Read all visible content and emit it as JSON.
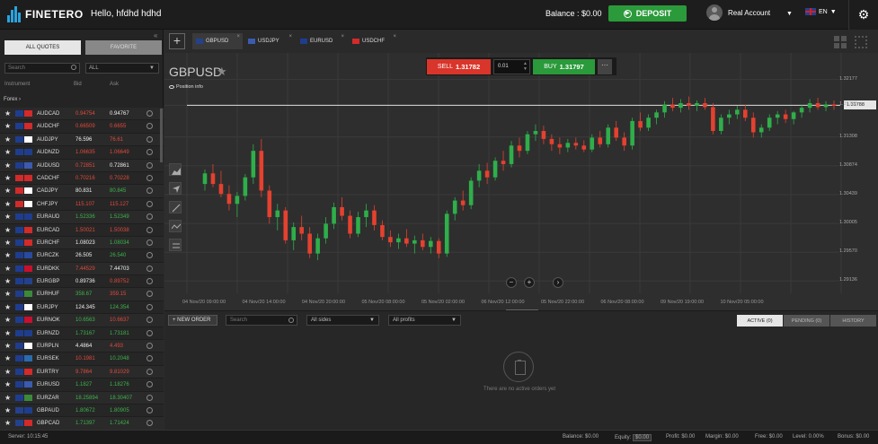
{
  "header": {
    "logo_text": "FINETERO",
    "greeting": "Hello, hfdhd hdhd",
    "balance": "Balance : $0.00",
    "deposit_label": "DEPOSIT",
    "account_label": "Real Account",
    "language": "EN",
    "colors": {
      "accent_green": "#2a9a3a",
      "sell_red": "#d9352b",
      "brand_blue": "#2aa3e0"
    }
  },
  "sidebar": {
    "tabs": [
      "ALL QUOTES",
      "FAVORITE"
    ],
    "search_placeholder": "Search",
    "filter_value": "ALL",
    "columns": [
      "Instrument",
      "Bid",
      "Ask"
    ],
    "group": "Forex",
    "rows": [
      {
        "symbol": "AUDCAD",
        "bid": "0.94754",
        "ask": "0.94767",
        "bid_color": "red",
        "ask_color": "white",
        "f1": "#1e3d8f",
        "f2": "#d32a2a"
      },
      {
        "symbol": "AUDCHF",
        "bid": "0.66509",
        "ask": "0.6655",
        "bid_color": "red",
        "ask_color": "red",
        "f1": "#1e3d8f",
        "f2": "#d32a2a"
      },
      {
        "symbol": "AUDJPY",
        "bid": "76.596",
        "ask": "76.61",
        "bid_color": "white",
        "ask_color": "red",
        "f1": "#1e3d8f",
        "f2": "#ffffff"
      },
      {
        "symbol": "AUDNZD",
        "bid": "1.06635",
        "ask": "1.06649",
        "bid_color": "red",
        "ask_color": "red",
        "f1": "#1e3d8f",
        "f2": "#1e3d8f"
      },
      {
        "symbol": "AUDUSD",
        "bid": "0.72851",
        "ask": "0.72861",
        "bid_color": "red",
        "ask_color": "white",
        "f1": "#1e3d8f",
        "f2": "#3b5bb0"
      },
      {
        "symbol": "CADCHF",
        "bid": "0.70216",
        "ask": "0.70228",
        "bid_color": "red",
        "ask_color": "red",
        "f1": "#d32a2a",
        "f2": "#d32a2a"
      },
      {
        "symbol": "CADJPY",
        "bid": "80.831",
        "ask": "80.845",
        "bid_color": "white",
        "ask_color": "green",
        "f1": "#d32a2a",
        "f2": "#ffffff"
      },
      {
        "symbol": "CHFJPY",
        "bid": "115.107",
        "ask": "115.127",
        "bid_color": "red",
        "ask_color": "red",
        "f1": "#d32a2a",
        "f2": "#ffffff"
      },
      {
        "symbol": "EURAUD",
        "bid": "1.52336",
        "ask": "1.52349",
        "bid_color": "green",
        "ask_color": "green",
        "f1": "#1e3d8f",
        "f2": "#1e3d8f"
      },
      {
        "symbol": "EURCAD",
        "bid": "1.50021",
        "ask": "1.50038",
        "bid_color": "red",
        "ask_color": "red",
        "f1": "#1e3d8f",
        "f2": "#d32a2a"
      },
      {
        "symbol": "EURCHF",
        "bid": "1.08023",
        "ask": "1.08034",
        "bid_color": "white",
        "ask_color": "green",
        "f1": "#1e3d8f",
        "f2": "#d32a2a"
      },
      {
        "symbol": "EURCZK",
        "bid": "26.505",
        "ask": "26.540",
        "bid_color": "white",
        "ask_color": "green",
        "f1": "#1e3d8f",
        "f2": "#2a4aa0"
      },
      {
        "symbol": "EURDKK",
        "bid": "7.44529",
        "ask": "7.44703",
        "bid_color": "red",
        "ask_color": "white",
        "f1": "#1e3d8f",
        "f2": "#c8102e"
      },
      {
        "symbol": "EURGBP",
        "bid": "0.89736",
        "ask": "0.89752",
        "bid_color": "white",
        "ask_color": "red",
        "f1": "#1e3d8f",
        "f2": "#24418e"
      },
      {
        "symbol": "EURHUF",
        "bid": "358.67",
        "ask": "359.15",
        "bid_color": "green",
        "ask_color": "red",
        "f1": "#1e3d8f",
        "f2": "#3a8a3a"
      },
      {
        "symbol": "EURJPY",
        "bid": "124.345",
        "ask": "124.354",
        "bid_color": "white",
        "ask_color": "green",
        "f1": "#1e3d8f",
        "f2": "#ffffff"
      },
      {
        "symbol": "EURNOK",
        "bid": "10.6563",
        "ask": "10.6637",
        "bid_color": "green",
        "ask_color": "red",
        "f1": "#1e3d8f",
        "f2": "#c8102e"
      },
      {
        "symbol": "EURNZD",
        "bid": "1.73167",
        "ask": "1.73181",
        "bid_color": "green",
        "ask_color": "green",
        "f1": "#1e3d8f",
        "f2": "#1e3d8f"
      },
      {
        "symbol": "EURPLN",
        "bid": "4.4864",
        "ask": "4.493",
        "bid_color": "white",
        "ask_color": "red",
        "f1": "#1e3d8f",
        "f2": "#ffffff"
      },
      {
        "symbol": "EURSEK",
        "bid": "10.1981",
        "ask": "10.2048",
        "bid_color": "red",
        "ask_color": "green",
        "f1": "#1e3d8f",
        "f2": "#2a6bb0"
      },
      {
        "symbol": "EURTRY",
        "bid": "9.7864",
        "ask": "9.81029",
        "bid_color": "red",
        "ask_color": "red",
        "f1": "#1e3d8f",
        "f2": "#d32a2a"
      },
      {
        "symbol": "EURUSD",
        "bid": "1.1827",
        "ask": "1.18276",
        "bid_color": "green",
        "ask_color": "green",
        "f1": "#1e3d8f",
        "f2": "#3b5bb0"
      },
      {
        "symbol": "EURZAR",
        "bid": "18.25894",
        "ask": "18.30407",
        "bid_color": "green",
        "ask_color": "green",
        "f1": "#1e3d8f",
        "f2": "#3a8a3a"
      },
      {
        "symbol": "GBPAUD",
        "bid": "1.80672",
        "ask": "1.80905",
        "bid_color": "green",
        "ask_color": "green",
        "f1": "#24418e",
        "f2": "#1e3d8f"
      },
      {
        "symbol": "GBPCAD",
        "bid": "1.71397",
        "ask": "1.71424",
        "bid_color": "green",
        "ask_color": "green",
        "f1": "#24418e",
        "f2": "#d32a2a"
      }
    ]
  },
  "chart_tabs": [
    {
      "symbol": "GBPUSD",
      "f1": "#24418e"
    },
    {
      "symbol": "USDJPY",
      "f1": "#3b5bb0"
    },
    {
      "symbol": "EURUSD",
      "f1": "#1e3d8f"
    },
    {
      "symbol": "USDCHF",
      "f1": "#d32a2a"
    }
  ],
  "chart": {
    "title": "GBPUSD",
    "position_info": "Position info",
    "sell_label": "SELL",
    "sell_price": "1.31782",
    "lot_value": "0.01",
    "buy_label": "BUY",
    "buy_price": "1.31797",
    "current_price_label": "1.31788"
  },
  "chart_data": {
    "type": "candlestick",
    "y_ticks": [
      "1.32177",
      "1.31788",
      "1.31308",
      "1.30874",
      "1.30439",
      "1.30005",
      "1.29570",
      "1.29136"
    ],
    "y_tick_values": [
      1.32177,
      1.31788,
      1.31308,
      1.30874,
      1.30439,
      1.30005,
      1.2957,
      1.29136
    ],
    "ylim": [
      1.2895,
      1.3228
    ],
    "x_ticks": [
      "04 Nov/20 09:00:00",
      "04 Nov/20 14:00:00",
      "04 Nov/20 20:00:00",
      "05 Nov/20 08:00:00",
      "05 Nov/20 02:00:00",
      "06 Nov/20 12:00:00",
      "05 Nov/20 22:00:00",
      "06 Nov/20 08:00:00",
      "09 Nov/20 19:00:00",
      "10 Nov/20 05:00:00"
    ],
    "current_price": 1.31788,
    "candles": [
      [
        1.306,
        1.3082,
        1.305,
        1.3076
      ],
      [
        1.3076,
        1.309,
        1.3055,
        1.306
      ],
      [
        1.306,
        1.308,
        1.304,
        1.3045
      ],
      [
        1.3045,
        1.3058,
        1.302,
        1.303
      ],
      [
        1.303,
        1.3048,
        1.301,
        1.3042
      ],
      [
        1.3042,
        1.3075,
        1.3035,
        1.307
      ],
      [
        1.307,
        1.312,
        1.306,
        1.311
      ],
      [
        1.311,
        1.3128,
        1.304,
        1.305
      ],
      [
        1.305,
        1.3058,
        1.3,
        1.301
      ],
      [
        1.301,
        1.303,
        1.299,
        1.302
      ],
      [
        1.302,
        1.3025,
        1.297,
        1.2975
      ],
      [
        1.2975,
        1.3002,
        1.296,
        1.2995
      ],
      [
        1.2995,
        1.3012,
        1.2975,
        1.2985
      ],
      [
        1.2985,
        1.2995,
        1.2948,
        1.2955
      ],
      [
        1.2955,
        1.2985,
        1.2945,
        1.2978
      ],
      [
        1.2978,
        1.301,
        1.297,
        1.3
      ],
      [
        1.3,
        1.3032,
        1.2992,
        1.3025
      ],
      [
        1.3025,
        1.304,
        1.3005,
        1.3012
      ],
      [
        1.3012,
        1.302,
        1.2978,
        1.2985
      ],
      [
        1.2985,
        1.3018,
        1.298,
        1.301
      ],
      [
        1.301,
        1.303,
        1.2995,
        1.302
      ],
      [
        1.302,
        1.3028,
        1.299,
        1.2998
      ],
      [
        1.2998,
        1.3005,
        1.2975,
        1.298
      ],
      [
        1.298,
        1.299,
        1.2965,
        1.2972
      ],
      [
        1.2972,
        1.2985,
        1.2962,
        1.2978
      ],
      [
        1.2978,
        1.2992,
        1.2965,
        1.297
      ],
      [
        1.297,
        1.2982,
        1.2955,
        1.2975
      ],
      [
        1.2975,
        1.2985,
        1.296,
        1.2965
      ],
      [
        1.2965,
        1.298,
        1.2955,
        1.2974
      ],
      [
        1.2974,
        1.2978,
        1.2948,
        1.2955
      ],
      [
        1.2955,
        1.302,
        1.295,
        1.3015
      ],
      [
        1.3015,
        1.304,
        1.3005,
        1.3035
      ],
      [
        1.3035,
        1.305,
        1.302,
        1.3028
      ],
      [
        1.3028,
        1.307,
        1.3022,
        1.3065
      ],
      [
        1.3065,
        1.309,
        1.3055,
        1.308
      ],
      [
        1.308,
        1.3092,
        1.306,
        1.307
      ],
      [
        1.307,
        1.31,
        1.3065,
        1.3095
      ],
      [
        1.3095,
        1.311,
        1.308,
        1.309
      ],
      [
        1.309,
        1.3125,
        1.3085,
        1.3118
      ],
      [
        1.3118,
        1.313,
        1.31,
        1.311
      ],
      [
        1.311,
        1.314,
        1.3105,
        1.3135
      ],
      [
        1.3135,
        1.315,
        1.3125,
        1.314
      ],
      [
        1.314,
        1.3148,
        1.312,
        1.3128
      ],
      [
        1.3128,
        1.3135,
        1.311,
        1.312
      ],
      [
        1.312,
        1.313,
        1.3105,
        1.3115
      ],
      [
        1.3115,
        1.3128,
        1.3108,
        1.3122
      ],
      [
        1.3122,
        1.313,
        1.3112,
        1.3118
      ],
      [
        1.3118,
        1.3126,
        1.3108,
        1.3112
      ],
      [
        1.3112,
        1.3135,
        1.3108,
        1.313
      ],
      [
        1.313,
        1.314,
        1.3115,
        1.312
      ],
      [
        1.312,
        1.315,
        1.3115,
        1.3145
      ],
      [
        1.3145,
        1.3155,
        1.3125,
        1.313
      ],
      [
        1.313,
        1.3138,
        1.311,
        1.3118
      ],
      [
        1.3118,
        1.316,
        1.3112,
        1.3155
      ],
      [
        1.3155,
        1.3168,
        1.314,
        1.3145
      ],
      [
        1.3145,
        1.3165,
        1.314,
        1.316
      ],
      [
        1.316,
        1.3172,
        1.315,
        1.3168
      ],
      [
        1.3168,
        1.3185,
        1.316,
        1.318
      ],
      [
        1.318,
        1.319,
        1.317,
        1.3175
      ],
      [
        1.3175,
        1.3188,
        1.3168,
        1.3182
      ],
      [
        1.3182,
        1.3192,
        1.3172,
        1.3178
      ],
      [
        1.3178,
        1.3186,
        1.317,
        1.3182
      ],
      [
        1.3182,
        1.319,
        1.3172,
        1.3176
      ],
      [
        1.3176,
        1.3182,
        1.3135,
        1.314
      ],
      [
        1.314,
        1.3165,
        1.3135,
        1.316
      ],
      [
        1.316,
        1.3172,
        1.315,
        1.3165
      ],
      [
        1.3165,
        1.3178,
        1.3158,
        1.3172
      ],
      [
        1.3172,
        1.318,
        1.3155,
        1.316
      ],
      [
        1.316,
        1.3168,
        1.313,
        1.3138
      ],
      [
        1.3138,
        1.315,
        1.313,
        1.3145
      ],
      [
        1.3145,
        1.3165,
        1.314,
        1.316
      ],
      [
        1.316,
        1.317,
        1.315,
        1.3165
      ],
      [
        1.3165,
        1.3172,
        1.3152,
        1.3158
      ],
      [
        1.3158,
        1.317,
        1.315,
        1.3168
      ],
      [
        1.3168,
        1.318,
        1.316,
        1.3175
      ],
      [
        1.3175,
        1.3188,
        1.3168,
        1.3182
      ],
      [
        1.3182,
        1.319,
        1.3172,
        1.3176
      ],
      [
        1.3176,
        1.3185,
        1.317,
        1.318
      ],
      [
        1.318,
        1.3186,
        1.3172,
        1.3178
      ]
    ]
  },
  "orders": {
    "new_order": "+ NEW ORDER",
    "search_placeholder": "Search",
    "sides": "All sides",
    "profits": "All profits",
    "tabs": [
      "ACTIVE (0)",
      "PENDING (0)",
      "HISTORY"
    ],
    "empty_text": "There are no active orders yet"
  },
  "footer": {
    "server": "Server: 10:15:45",
    "balance": "Balance: $0.00",
    "equity_label": "Equity:",
    "equity_value": "$0.00",
    "profit": "Profit: $0.00",
    "margin": "Margin: $0.00",
    "free": "Free: $0.00",
    "level": "Level: 0.00%",
    "bonus": "Bonus: $0.00"
  }
}
